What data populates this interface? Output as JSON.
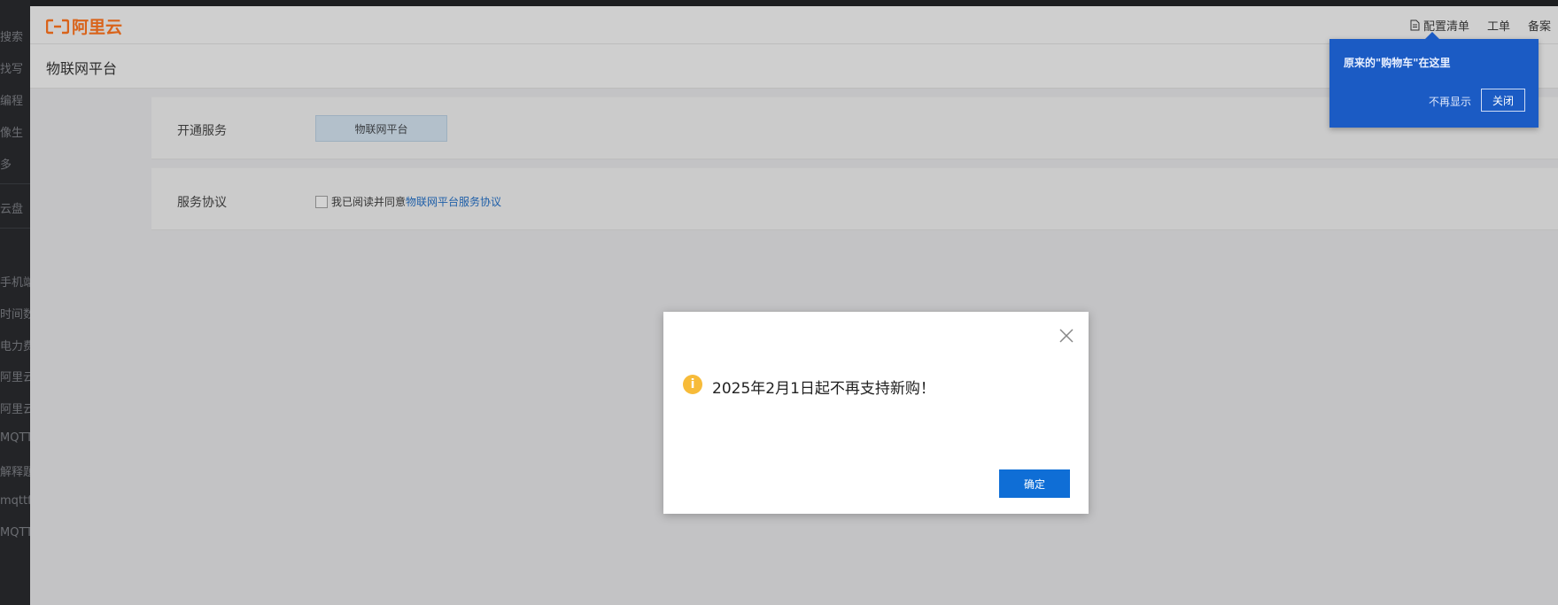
{
  "left_fragments": [
    "搜索",
    "找写",
    "编程",
    "像生",
    "多",
    "云盘",
    "",
    "手机端",
    "时间数",
    "电力费",
    "阿里云",
    "阿里云",
    "MQTT",
    "解释题",
    "mqttf",
    "MQTT"
  ],
  "header": {
    "logo_text": "阿里云",
    "nav": [
      {
        "label": "配置清单",
        "icon": "document-icon"
      },
      {
        "label": "工单"
      },
      {
        "label": "备案"
      }
    ]
  },
  "page": {
    "title": "物联网平台"
  },
  "form": {
    "service_label": "开通服务",
    "service_button": "物联网平台",
    "agreement_label": "服务协议",
    "agreement_text": "我已阅读并同意",
    "agreement_link": "物联网平台服务协议",
    "agreement_checked": false
  },
  "tooltip": {
    "message": "原来的\"购物车\"在这里",
    "no_more": "不再显示",
    "close": "关闭"
  },
  "modal": {
    "message": "2025年2月1日起不再支持新购！",
    "icon_glyph": "i",
    "ok": "确定"
  },
  "colors": {
    "accent": "#0f6ed6",
    "tooltip_bg": "#1b5bc4",
    "logo": "#d9631a",
    "warning": "#f7bb39"
  }
}
